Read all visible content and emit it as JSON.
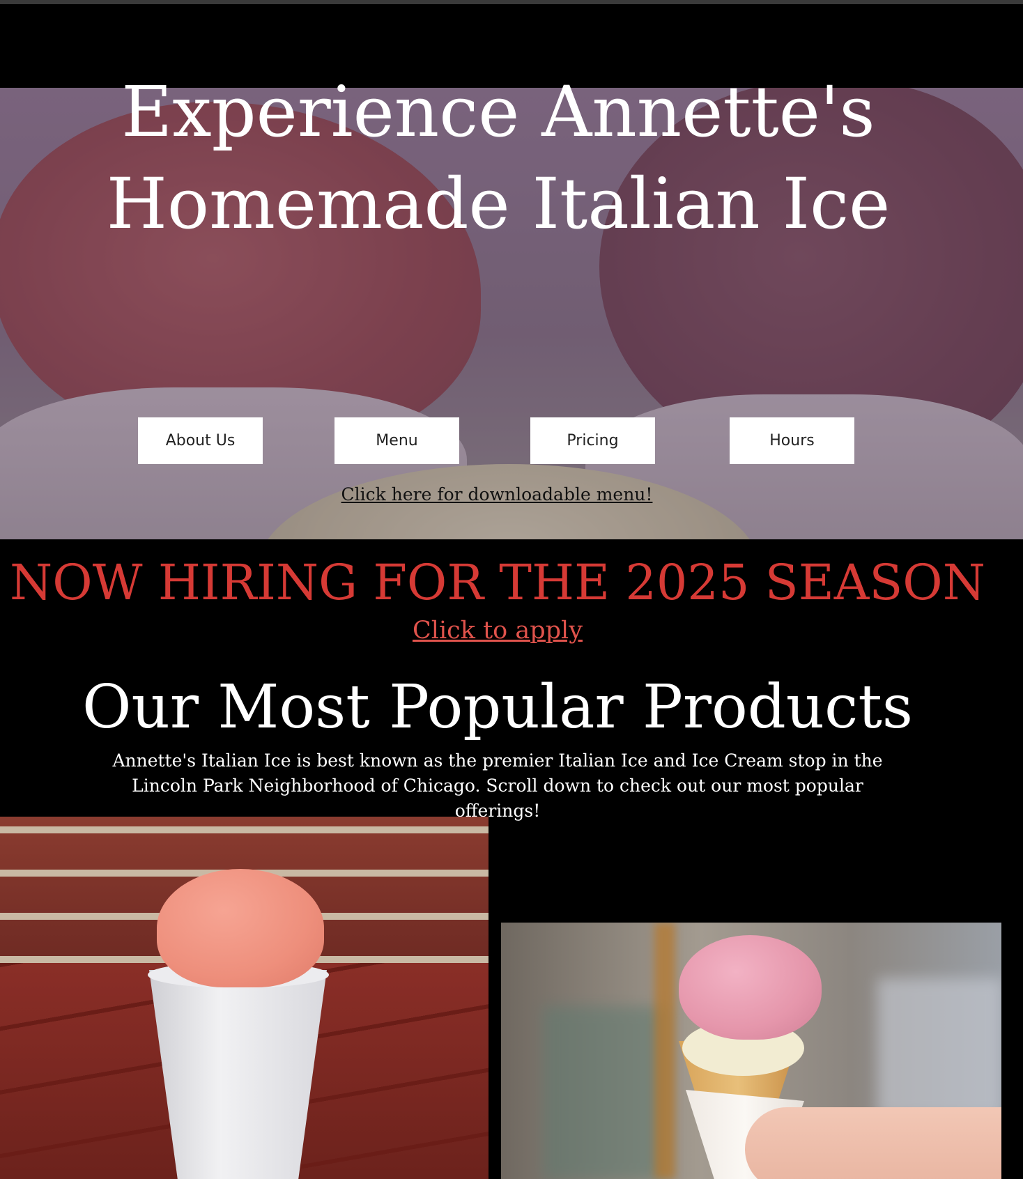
{
  "hero": {
    "title_line1": "Experience Annette's",
    "title_line2": "Homemade Italian Ice",
    "nav": [
      {
        "label": "About Us"
      },
      {
        "label": "Menu"
      },
      {
        "label": "Pricing"
      },
      {
        "label": "Hours"
      }
    ],
    "menu_link": "Click here for downloadable menu!"
  },
  "hiring": {
    "title": "NOW HIRING FOR THE 2025 SEASON",
    "apply_link": "Click to apply"
  },
  "products": {
    "title": "Our Most Popular Products",
    "description": "Annette's Italian Ice is best known as the premier Italian Ice and Ice Cream stop in the Lincoln Park Neighborhood of Chicago. Scroll down to check out our most popular offerings!"
  },
  "colors": {
    "background": "#000000",
    "hiring_red": "#d63a35",
    "button_bg": "#ffffff"
  }
}
